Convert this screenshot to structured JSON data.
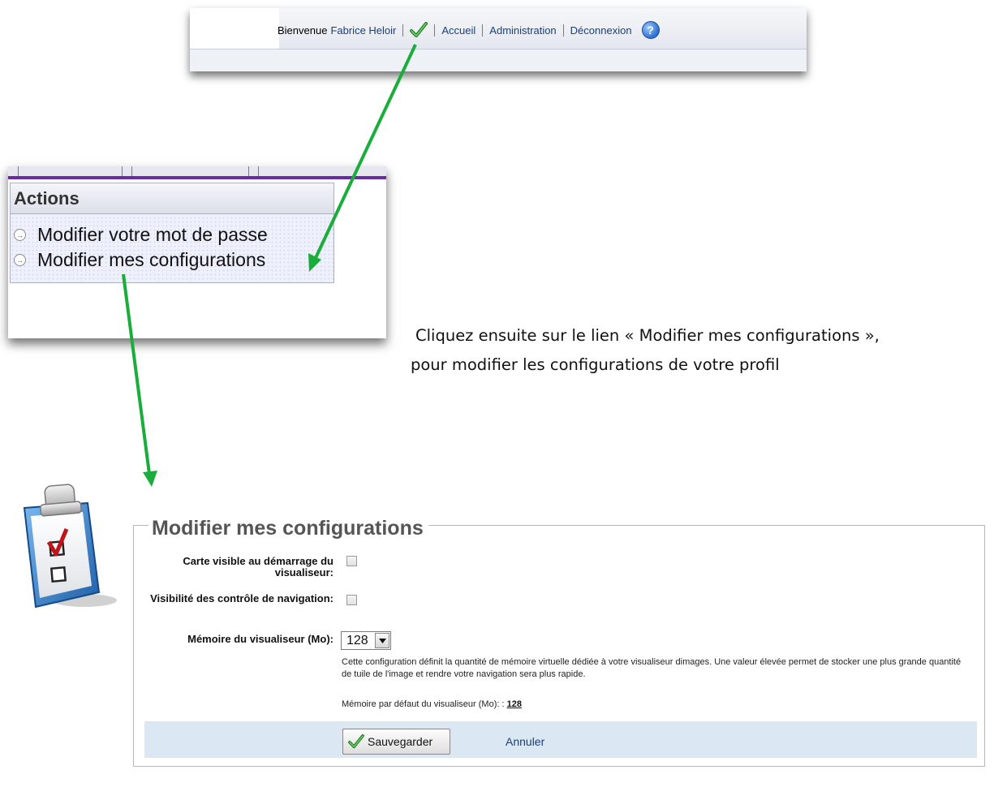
{
  "header_nav": {
    "welcome_prefix": "Bienvenue",
    "user_name": "Fabrice Heloir",
    "check_icon": "check-icon",
    "home": "Accueil",
    "admin": "Administration",
    "logout": "Déconnexion",
    "help_icon": "help-icon",
    "help_glyph": "?"
  },
  "actions_panel": {
    "title": "Actions",
    "items": [
      {
        "label": "Modifier votre mot de passe",
        "icon": "arrow-circle-icon"
      },
      {
        "label": "Modifier mes configurations",
        "icon": "arrow-circle-icon"
      }
    ]
  },
  "instruction": {
    "line1": "Cliquez ensuite sur le lien « Modifier mes configurations »,",
    "line2": "pour modifier les configurations de votre profil"
  },
  "config_form": {
    "legend": "Modifier mes configurations",
    "map_visible_label": "Carte visible au démarrage du visualiseur:",
    "map_visible_checked": false,
    "nav_visibility_label": "Visibilité des contrôle de navigation:",
    "nav_visibility_checked": false,
    "memory_label": "Mémoire du visualiseur (Mo):",
    "memory_value": "128",
    "memory_help": "Cette configuration définit la quantité de mémoire virtuelle dédiée à votre visualiseur dimages. Une valeur élevée permet de stocker une plus grande quantité de tuile de l'image et rendre votre navigation sera plus rapide.",
    "default_label": "Mémoire par défaut du visualiseur (Mo): :",
    "default_value": "128",
    "save_label": "Sauvegarder",
    "cancel_label": "Annuler"
  },
  "colors": {
    "arrow": "#1aad3c",
    "link": "#1a3f7a",
    "purple_rule": "#6a2aa0",
    "button_bar": "#dbe8f4"
  }
}
